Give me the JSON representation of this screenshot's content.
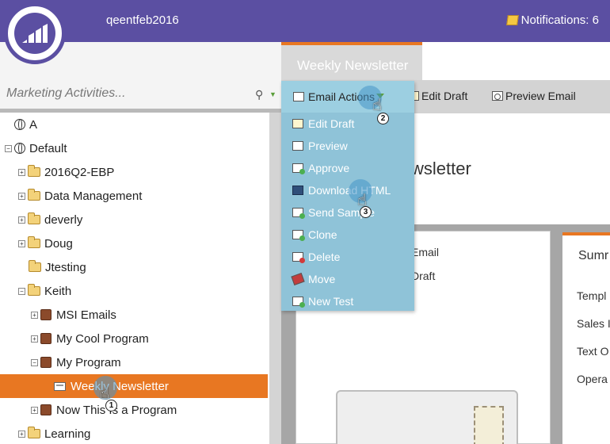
{
  "header": {
    "username": "qeentfeb2016",
    "notifications_label": "Notifications: 6"
  },
  "search": {
    "placeholder": "Marketing Activities..."
  },
  "tree": [
    {
      "label": "A",
      "icon": "globe-icon",
      "expander": "",
      "selected": false
    },
    {
      "label": "Default",
      "icon": "globe-icon",
      "expander": "−",
      "selected": false
    },
    {
      "label": "2016Q2-EBP",
      "icon": "folder-icon",
      "expander": "+",
      "selected": false
    },
    {
      "label": "Data Management",
      "icon": "folder-icon",
      "expander": "+",
      "selected": false
    },
    {
      "label": "deverly",
      "icon": "folder-icon",
      "expander": "+",
      "selected": false
    },
    {
      "label": "Doug",
      "icon": "folder-icon",
      "expander": "+",
      "selected": false
    },
    {
      "label": "Jtesting",
      "icon": "folder-icon",
      "expander": "",
      "selected": false
    },
    {
      "label": "Keith",
      "icon": "folder-icon",
      "expander": "−",
      "selected": false
    },
    {
      "label": "MSI Emails",
      "icon": "program-icon",
      "expander": "+",
      "selected": false
    },
    {
      "label": "My Cool Program",
      "icon": "program-icon",
      "expander": "+",
      "selected": false
    },
    {
      "label": "My Program",
      "icon": "program-icon",
      "expander": "−",
      "selected": false
    },
    {
      "label": "Weekly Newsletter",
      "icon": "email-icon",
      "expander": "",
      "selected": true
    },
    {
      "label": "Now This Is a Program",
      "icon": "program-icon",
      "expander": "+",
      "selected": false
    },
    {
      "label": "Learning",
      "icon": "folder-icon",
      "expander": "+",
      "selected": false
    }
  ],
  "tab": {
    "label": "Weekly Newsletter"
  },
  "toolbar": {
    "email_actions": "Email Actions",
    "edit_draft": "Edit Draft",
    "preview_email": "Preview Email"
  },
  "dropdown": {
    "items": [
      {
        "label": "Edit Draft",
        "icon": "edit-icon"
      },
      {
        "label": "Preview",
        "icon": "preview-icon"
      },
      {
        "label": "Approve",
        "icon": "approve-icon"
      },
      {
        "label": "Download HTML",
        "icon": "download-icon"
      },
      {
        "label": "Send Sample",
        "icon": "send-sample-icon"
      },
      {
        "label": "Clone",
        "icon": "clone-icon"
      },
      {
        "label": "Delete",
        "icon": "delete-icon"
      },
      {
        "label": "Move",
        "icon": "move-icon"
      },
      {
        "label": "New Test",
        "icon": "new-test-icon"
      }
    ]
  },
  "content": {
    "title_fragment": "wsletter",
    "panel_a_lines": [
      "Email",
      "Draft"
    ],
    "panel_b_title": "Sumr",
    "panel_b_rows": [
      "Templ",
      "Sales I",
      "Text O",
      "Opera"
    ]
  },
  "markers": [
    {
      "number": "1"
    },
    {
      "number": "2"
    },
    {
      "number": "3"
    }
  ],
  "colors": {
    "header_bg": "#5b4fa2",
    "accent_orange": "#e87722",
    "dropdown_bg": "#8fc3d8"
  }
}
